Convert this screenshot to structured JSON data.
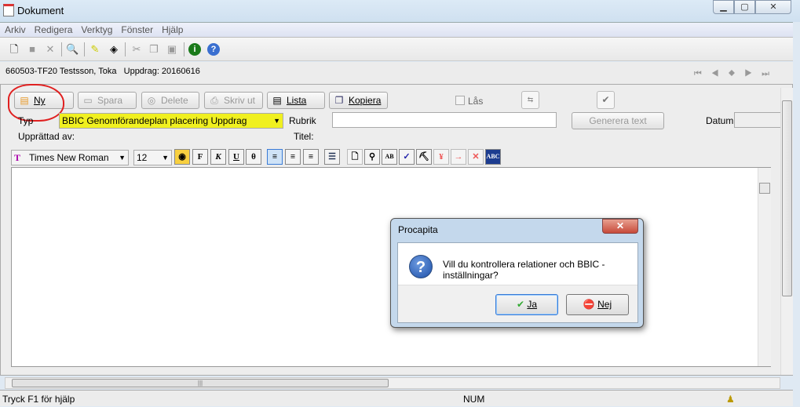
{
  "window": {
    "title": "Dokument",
    "icon": "document-icon"
  },
  "menu": [
    "Arkiv",
    "Redigera",
    "Verktyg",
    "Fönster",
    "Hjälp"
  ],
  "toolbar_icons": [
    "new-icon",
    "save-icon",
    "delete-icon",
    "find-icon",
    "edit-icon",
    "stamp-icon",
    "cut-icon",
    "copy-icon",
    "paste-icon",
    "info-icon",
    "help-icon"
  ],
  "info": {
    "text": "660503-TF20 Testsson, Toka   Uppdrag: 20160616"
  },
  "buttons": {
    "ny": "Ny",
    "spara": "Spara",
    "delete": "Delete",
    "skriv_ut": "Skriv ut",
    "lista": "Lista",
    "kopiera": "Kopiera",
    "las": "Lås",
    "generera": "Generera text"
  },
  "form": {
    "typ_label": "Typ",
    "typ_value": "BBIC Genomförandeplan placering Uppdrag",
    "rubrik_label": "Rubrik",
    "rubrik_value": "",
    "datum_label": "Datum",
    "datum_value": "",
    "upprattad_label": "Upprättad av:",
    "titel_label": "Titel:",
    "highlight_color": "#f0f020",
    "annotation_color": "#e02020"
  },
  "format": {
    "font": "Times New Roman",
    "size": "12",
    "buttons": [
      "F",
      "K",
      "U",
      "θ"
    ]
  },
  "dialog": {
    "title": "Procapita",
    "message": "Vill du kontrollera relationer och BBIC - inställningar?",
    "yes": "Ja",
    "no": "Nej"
  },
  "status": {
    "help": "Tryck F1 för hjälp",
    "num": "NUM"
  }
}
